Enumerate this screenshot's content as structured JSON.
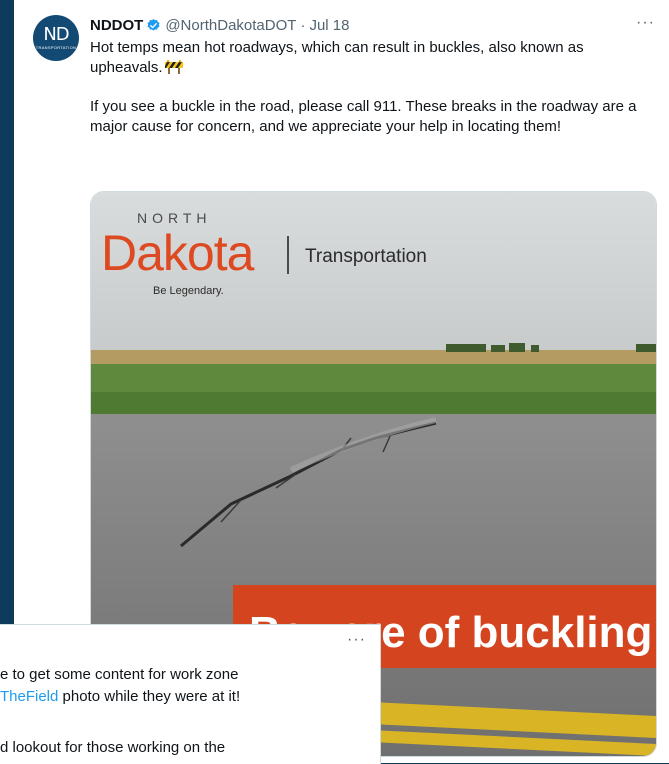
{
  "tweet": {
    "avatar_text": "ND",
    "avatar_subtext": "TRANSPORTATION",
    "display_name": "NDDOT",
    "handle": "@NorthDakotaDOT",
    "separator": "·",
    "date": "Jul 18",
    "more": "···",
    "paragraph1": "Hot temps mean hot roadways, which can result in buckles, also known as upheavals.",
    "paragraph2": "If you see a buckle in the road, please call 911. These breaks in the roadway are a major cause for concern, and we appreciate your help in locating them!"
  },
  "media": {
    "logo_north": "NORTH",
    "logo_dakota": "Dakota",
    "logo_transportation": "Transportation",
    "logo_tagline": "Be Legendary.",
    "banner": "Beware of buckling!",
    "colors": {
      "brand_orange": "#dd4a22",
      "banner": "#d4441f",
      "avatar_bg": "#124a74",
      "page_bg": "#0e3a5c"
    }
  },
  "overlap_tweet": {
    "more": "···",
    "line1": "e to get some content for work zone",
    "line2_link": "TheField",
    "line2_rest": " photo while they were at it!",
    "line3": "d lookout for those working on the"
  }
}
